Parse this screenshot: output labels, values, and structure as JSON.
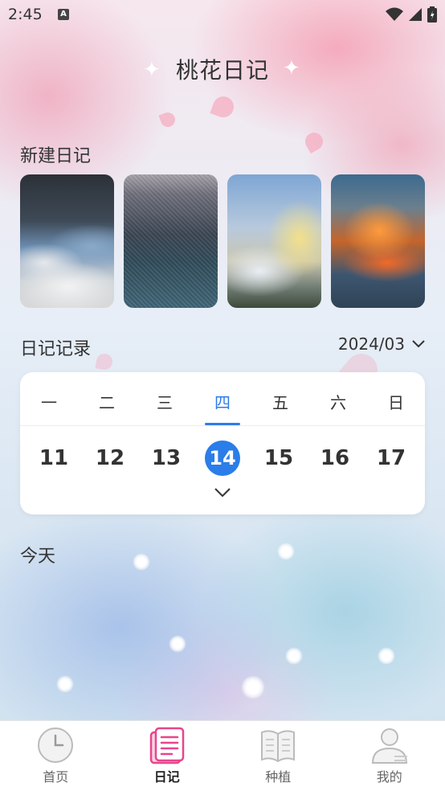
{
  "status_bar": {
    "time": "2:45",
    "notification_badge": "A"
  },
  "header": {
    "title": "桃花日记"
  },
  "new_diary": {
    "label": "新建日记",
    "thumbnails": [
      {
        "name": "cloudy-sky"
      },
      {
        "name": "rainy-water"
      },
      {
        "name": "rainbow-clouds"
      },
      {
        "name": "sunset-clouds"
      }
    ]
  },
  "records": {
    "label": "日记记录",
    "month": "2024/03"
  },
  "calendar": {
    "weekdays": [
      "一",
      "二",
      "三",
      "四",
      "五",
      "六",
      "日"
    ],
    "days": [
      "11",
      "12",
      "13",
      "14",
      "15",
      "16",
      "17"
    ],
    "selected_index": 3,
    "accent_color": "#2b7de9"
  },
  "today": {
    "label": "今天"
  },
  "tabbar": {
    "items": [
      {
        "label": "首页",
        "icon": "clock-icon"
      },
      {
        "label": "日记",
        "icon": "diary-icon",
        "active": true
      },
      {
        "label": "种植",
        "icon": "book-icon"
      },
      {
        "label": "我的",
        "icon": "user-icon"
      }
    ],
    "active_color": "#e8458b"
  }
}
